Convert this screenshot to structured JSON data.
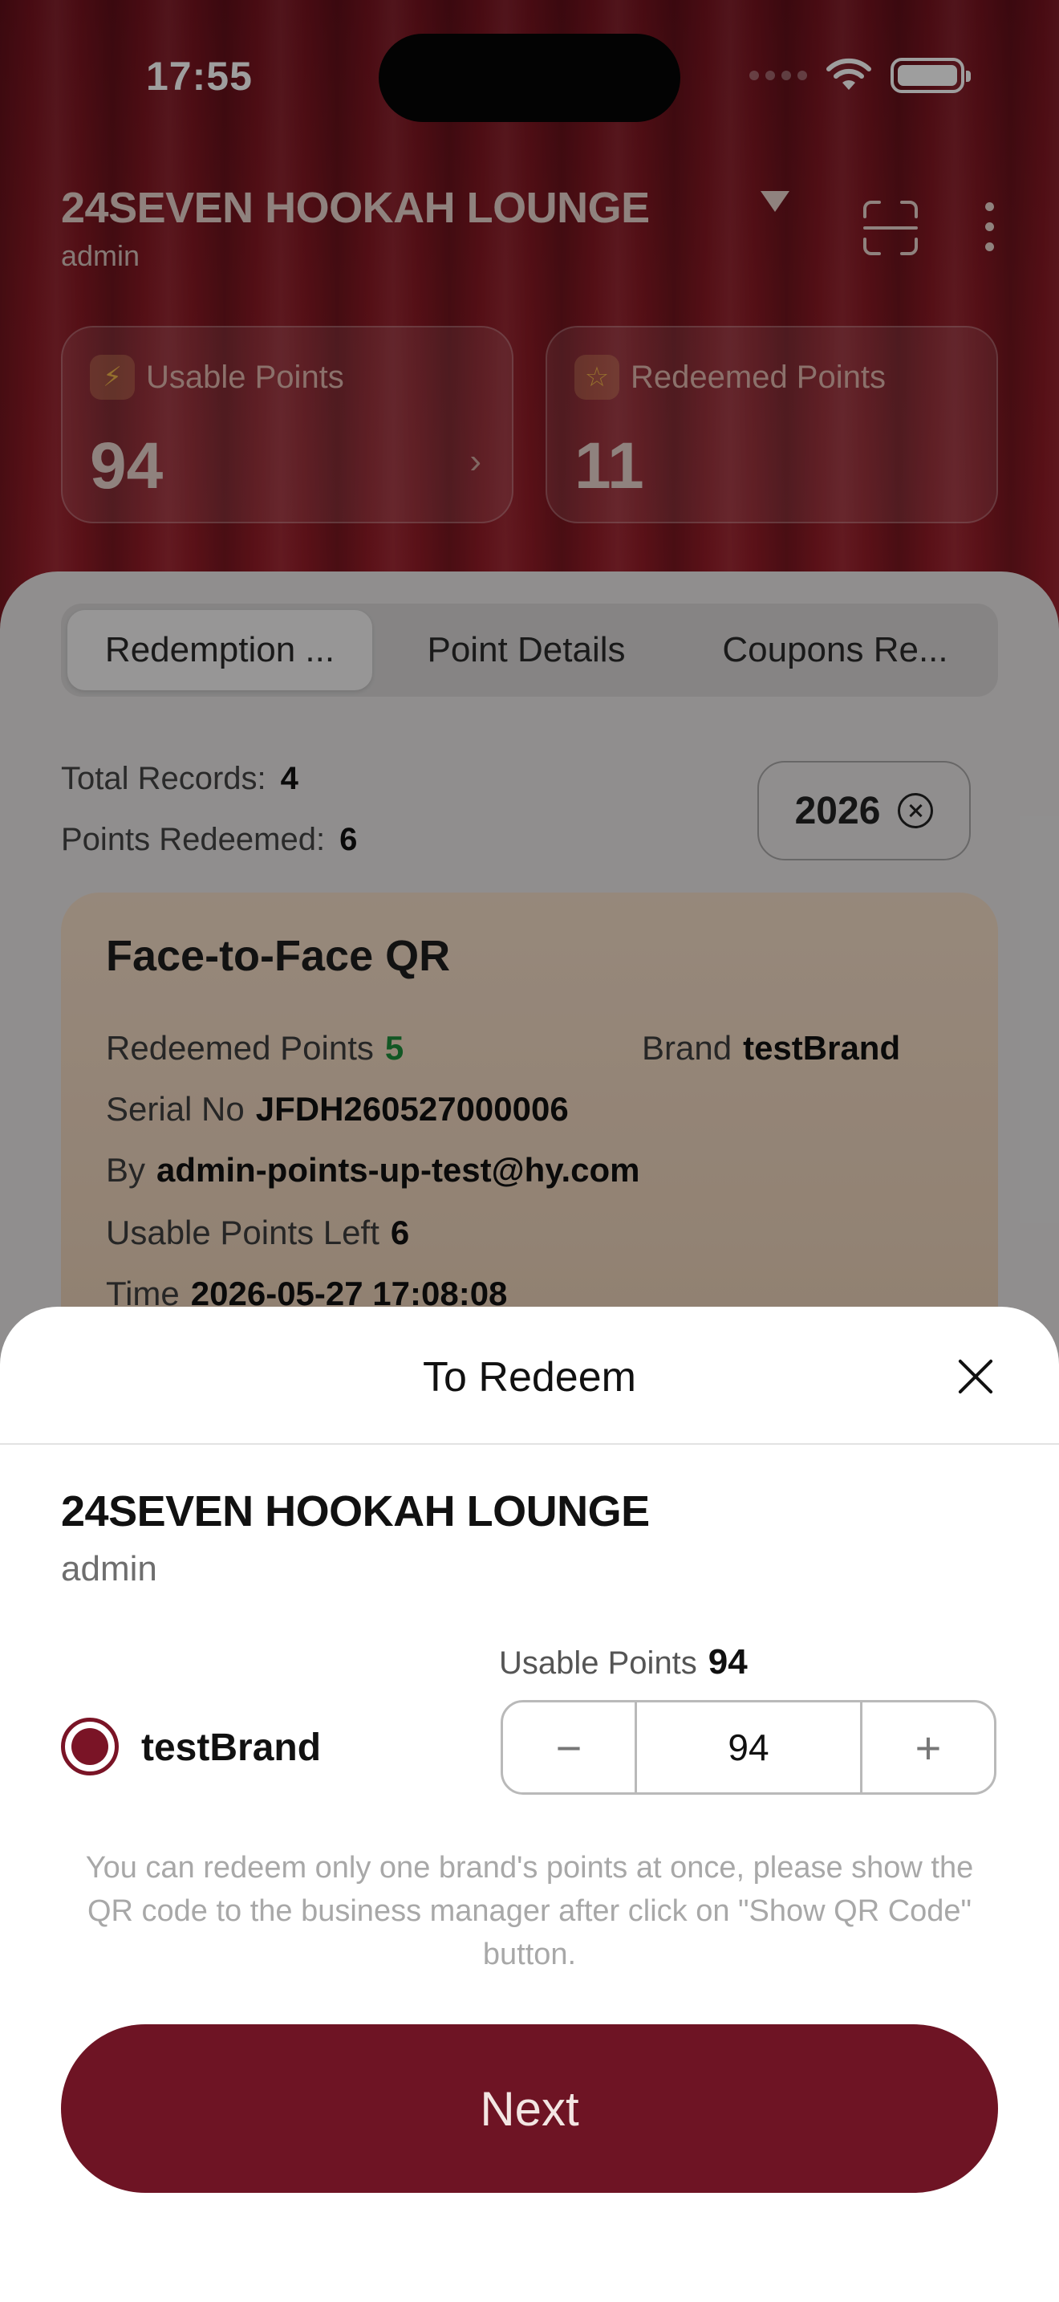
{
  "status_bar": {
    "time": "17:55"
  },
  "header": {
    "store_name": "24SEVEN HOOKAH LOUNGE",
    "role": "admin",
    "usable_points": {
      "label": "Usable Points",
      "value": "94"
    },
    "redeemed_points": {
      "label": "Redeemed Points",
      "value": "11"
    }
  },
  "tabs": [
    {
      "label": "Redemption ...",
      "active": true
    },
    {
      "label": "Point Details",
      "active": false
    },
    {
      "label": "Coupons Re...",
      "active": false
    }
  ],
  "summary": {
    "total_records_label": "Total Records:",
    "total_records_value": "4",
    "points_redeemed_label": "Points Redeemed:",
    "points_redeemed_value": "6",
    "year_filter": "2026"
  },
  "record": {
    "title": "Face-to-Face QR",
    "redeemed_points_label": "Redeemed Points",
    "redeemed_points_value": "5",
    "brand_label": "Brand",
    "brand_value": "testBrand",
    "serial_label": "Serial No",
    "serial_value": "JFDH260527000006",
    "by_label": "By",
    "by_value": "admin-points-up-test@hy.com",
    "usable_left_label": "Usable Points Left",
    "usable_left_value": "6",
    "time_label": "Time",
    "time_value": "2026-05-27 17:08:08"
  },
  "sheet": {
    "title": "To Redeem",
    "store_name": "24SEVEN HOOKAH LOUNGE",
    "role": "admin",
    "usable_points_label": "Usable Points",
    "usable_points_value": "94",
    "brand": "testBrand",
    "stepper": {
      "minus": "−",
      "value": "94",
      "plus": "+"
    },
    "notice": "You can redeem only one brand's points at once, please show the QR code to the business manager after click on \"Show QR Code\" button.",
    "next_label": "Next"
  },
  "colors": {
    "brand_accent": "#6e1424",
    "positive": "#1e8d3a"
  }
}
